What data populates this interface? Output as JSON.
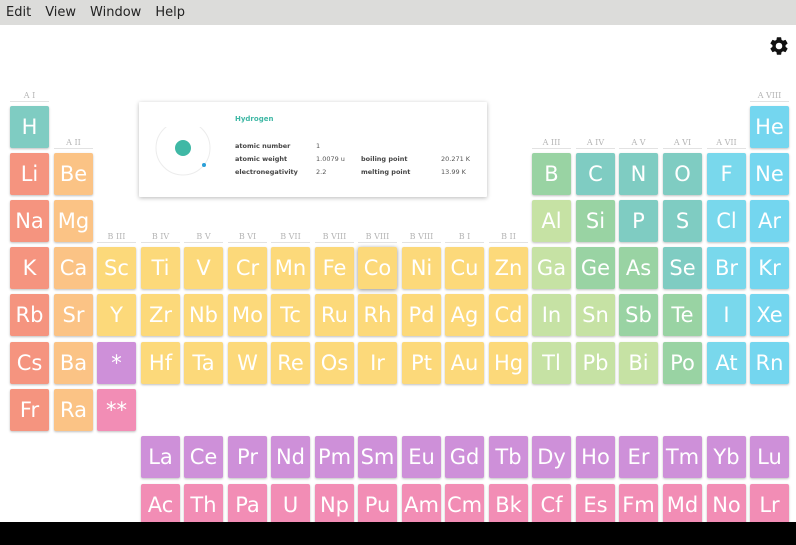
{
  "menu": [
    "Edit",
    "View",
    "Window",
    "Help"
  ],
  "colors": {
    "alkali": "#f5947f",
    "alkaline": "#fbc385",
    "transition": "#fcd97a",
    "post_transition": "#c6e2a4",
    "metalloid": "#99d3a3",
    "nonmetal": "#7fccc2",
    "halogen": "#79d8ec",
    "noble": "#74d6ef",
    "lanthanide": "#ce90d9",
    "actinide": "#f28db5",
    "hydrogen": "#7fccc2"
  },
  "group_labels": [
    "A I",
    "A II",
    "B III",
    "B IV",
    "B V",
    "B VI",
    "B VII",
    "B VIII",
    "B VIII",
    "B VIII",
    "B I",
    "B II",
    "A III",
    "A IV",
    "A V",
    "A VI",
    "A VII",
    "A VIII"
  ],
  "elements": [
    {
      "s": "H",
      "r": 0,
      "c": 0,
      "t": "hydrogen"
    },
    {
      "s": "He",
      "r": 0,
      "c": 17,
      "t": "noble"
    },
    {
      "s": "Li",
      "r": 1,
      "c": 0,
      "t": "alkali"
    },
    {
      "s": "Be",
      "r": 1,
      "c": 1,
      "t": "alkaline"
    },
    {
      "s": "B",
      "r": 1,
      "c": 12,
      "t": "metalloid"
    },
    {
      "s": "C",
      "r": 1,
      "c": 13,
      "t": "nonmetal"
    },
    {
      "s": "N",
      "r": 1,
      "c": 14,
      "t": "nonmetal"
    },
    {
      "s": "O",
      "r": 1,
      "c": 15,
      "t": "nonmetal"
    },
    {
      "s": "F",
      "r": 1,
      "c": 16,
      "t": "halogen"
    },
    {
      "s": "Ne",
      "r": 1,
      "c": 17,
      "t": "noble"
    },
    {
      "s": "Na",
      "r": 2,
      "c": 0,
      "t": "alkali"
    },
    {
      "s": "Mg",
      "r": 2,
      "c": 1,
      "t": "alkaline"
    },
    {
      "s": "Al",
      "r": 2,
      "c": 12,
      "t": "post_transition"
    },
    {
      "s": "Si",
      "r": 2,
      "c": 13,
      "t": "metalloid"
    },
    {
      "s": "P",
      "r": 2,
      "c": 14,
      "t": "nonmetal"
    },
    {
      "s": "S",
      "r": 2,
      "c": 15,
      "t": "nonmetal"
    },
    {
      "s": "Cl",
      "r": 2,
      "c": 16,
      "t": "halogen"
    },
    {
      "s": "Ar",
      "r": 2,
      "c": 17,
      "t": "noble"
    },
    {
      "s": "K",
      "r": 3,
      "c": 0,
      "t": "alkali"
    },
    {
      "s": "Ca",
      "r": 3,
      "c": 1,
      "t": "alkaline"
    },
    {
      "s": "Sc",
      "r": 3,
      "c": 2,
      "t": "transition"
    },
    {
      "s": "Ti",
      "r": 3,
      "c": 3,
      "t": "transition"
    },
    {
      "s": "V",
      "r": 3,
      "c": 4,
      "t": "transition"
    },
    {
      "s": "Cr",
      "r": 3,
      "c": 5,
      "t": "transition"
    },
    {
      "s": "Mn",
      "r": 3,
      "c": 6,
      "t": "transition"
    },
    {
      "s": "Fe",
      "r": 3,
      "c": 7,
      "t": "transition"
    },
    {
      "s": "Co",
      "r": 3,
      "c": 8,
      "t": "transition",
      "selected": true
    },
    {
      "s": "Ni",
      "r": 3,
      "c": 9,
      "t": "transition"
    },
    {
      "s": "Cu",
      "r": 3,
      "c": 10,
      "t": "transition"
    },
    {
      "s": "Zn",
      "r": 3,
      "c": 11,
      "t": "transition"
    },
    {
      "s": "Ga",
      "r": 3,
      "c": 12,
      "t": "post_transition"
    },
    {
      "s": "Ge",
      "r": 3,
      "c": 13,
      "t": "metalloid"
    },
    {
      "s": "As",
      "r": 3,
      "c": 14,
      "t": "metalloid"
    },
    {
      "s": "Se",
      "r": 3,
      "c": 15,
      "t": "nonmetal"
    },
    {
      "s": "Br",
      "r": 3,
      "c": 16,
      "t": "halogen"
    },
    {
      "s": "Kr",
      "r": 3,
      "c": 17,
      "t": "noble"
    },
    {
      "s": "Rb",
      "r": 4,
      "c": 0,
      "t": "alkali"
    },
    {
      "s": "Sr",
      "r": 4,
      "c": 1,
      "t": "alkaline"
    },
    {
      "s": "Y",
      "r": 4,
      "c": 2,
      "t": "transition"
    },
    {
      "s": "Zr",
      "r": 4,
      "c": 3,
      "t": "transition"
    },
    {
      "s": "Nb",
      "r": 4,
      "c": 4,
      "t": "transition"
    },
    {
      "s": "Mo",
      "r": 4,
      "c": 5,
      "t": "transition"
    },
    {
      "s": "Tc",
      "r": 4,
      "c": 6,
      "t": "transition"
    },
    {
      "s": "Ru",
      "r": 4,
      "c": 7,
      "t": "transition"
    },
    {
      "s": "Rh",
      "r": 4,
      "c": 8,
      "t": "transition"
    },
    {
      "s": "Pd",
      "r": 4,
      "c": 9,
      "t": "transition"
    },
    {
      "s": "Ag",
      "r": 4,
      "c": 10,
      "t": "transition"
    },
    {
      "s": "Cd",
      "r": 4,
      "c": 11,
      "t": "transition"
    },
    {
      "s": "In",
      "r": 4,
      "c": 12,
      "t": "post_transition"
    },
    {
      "s": "Sn",
      "r": 4,
      "c": 13,
      "t": "post_transition"
    },
    {
      "s": "Sb",
      "r": 4,
      "c": 14,
      "t": "metalloid"
    },
    {
      "s": "Te",
      "r": 4,
      "c": 15,
      "t": "metalloid"
    },
    {
      "s": "I",
      "r": 4,
      "c": 16,
      "t": "halogen"
    },
    {
      "s": "Xe",
      "r": 4,
      "c": 17,
      "t": "noble"
    },
    {
      "s": "Cs",
      "r": 5,
      "c": 0,
      "t": "alkali"
    },
    {
      "s": "Ba",
      "r": 5,
      "c": 1,
      "t": "alkaline"
    },
    {
      "s": "*",
      "r": 5,
      "c": 2,
      "t": "lanthanide"
    },
    {
      "s": "Hf",
      "r": 5,
      "c": 3,
      "t": "transition"
    },
    {
      "s": "Ta",
      "r": 5,
      "c": 4,
      "t": "transition"
    },
    {
      "s": "W",
      "r": 5,
      "c": 5,
      "t": "transition"
    },
    {
      "s": "Re",
      "r": 5,
      "c": 6,
      "t": "transition"
    },
    {
      "s": "Os",
      "r": 5,
      "c": 7,
      "t": "transition"
    },
    {
      "s": "Ir",
      "r": 5,
      "c": 8,
      "t": "transition"
    },
    {
      "s": "Pt",
      "r": 5,
      "c": 9,
      "t": "transition"
    },
    {
      "s": "Au",
      "r": 5,
      "c": 10,
      "t": "transition"
    },
    {
      "s": "Hg",
      "r": 5,
      "c": 11,
      "t": "transition"
    },
    {
      "s": "Tl",
      "r": 5,
      "c": 12,
      "t": "post_transition"
    },
    {
      "s": "Pb",
      "r": 5,
      "c": 13,
      "t": "post_transition"
    },
    {
      "s": "Bi",
      "r": 5,
      "c": 14,
      "t": "post_transition"
    },
    {
      "s": "Po",
      "r": 5,
      "c": 15,
      "t": "metalloid"
    },
    {
      "s": "At",
      "r": 5,
      "c": 16,
      "t": "halogen"
    },
    {
      "s": "Rn",
      "r": 5,
      "c": 17,
      "t": "noble"
    },
    {
      "s": "Fr",
      "r": 6,
      "c": 0,
      "t": "alkali"
    },
    {
      "s": "Ra",
      "r": 6,
      "c": 1,
      "t": "alkaline"
    },
    {
      "s": "**",
      "r": 6,
      "c": 2,
      "t": "actinide"
    },
    {
      "s": "La",
      "r": 7,
      "c": 3,
      "t": "lanthanide"
    },
    {
      "s": "Ce",
      "r": 7,
      "c": 4,
      "t": "lanthanide"
    },
    {
      "s": "Pr",
      "r": 7,
      "c": 5,
      "t": "lanthanide"
    },
    {
      "s": "Nd",
      "r": 7,
      "c": 6,
      "t": "lanthanide"
    },
    {
      "s": "Pm",
      "r": 7,
      "c": 7,
      "t": "lanthanide"
    },
    {
      "s": "Sm",
      "r": 7,
      "c": 8,
      "t": "lanthanide"
    },
    {
      "s": "Eu",
      "r": 7,
      "c": 9,
      "t": "lanthanide"
    },
    {
      "s": "Gd",
      "r": 7,
      "c": 10,
      "t": "lanthanide"
    },
    {
      "s": "Tb",
      "r": 7,
      "c": 11,
      "t": "lanthanide"
    },
    {
      "s": "Dy",
      "r": 7,
      "c": 12,
      "t": "lanthanide"
    },
    {
      "s": "Ho",
      "r": 7,
      "c": 13,
      "t": "lanthanide"
    },
    {
      "s": "Er",
      "r": 7,
      "c": 14,
      "t": "lanthanide"
    },
    {
      "s": "Tm",
      "r": 7,
      "c": 15,
      "t": "lanthanide"
    },
    {
      "s": "Yb",
      "r": 7,
      "c": 16,
      "t": "lanthanide"
    },
    {
      "s": "Lu",
      "r": 7,
      "c": 17,
      "t": "lanthanide"
    },
    {
      "s": "Ac",
      "r": 8,
      "c": 3,
      "t": "actinide"
    },
    {
      "s": "Th",
      "r": 8,
      "c": 4,
      "t": "actinide"
    },
    {
      "s": "Pa",
      "r": 8,
      "c": 5,
      "t": "actinide"
    },
    {
      "s": "U",
      "r": 8,
      "c": 6,
      "t": "actinide"
    },
    {
      "s": "Np",
      "r": 8,
      "c": 7,
      "t": "actinide"
    },
    {
      "s": "Pu",
      "r": 8,
      "c": 8,
      "t": "actinide"
    },
    {
      "s": "Am",
      "r": 8,
      "c": 9,
      "t": "actinide"
    },
    {
      "s": "Cm",
      "r": 8,
      "c": 10,
      "t": "actinide"
    },
    {
      "s": "Bk",
      "r": 8,
      "c": 11,
      "t": "actinide"
    },
    {
      "s": "Cf",
      "r": 8,
      "c": 12,
      "t": "actinide"
    },
    {
      "s": "Es",
      "r": 8,
      "c": 13,
      "t": "actinide"
    },
    {
      "s": "Fm",
      "r": 8,
      "c": 14,
      "t": "actinide"
    },
    {
      "s": "Md",
      "r": 8,
      "c": 15,
      "t": "actinide"
    },
    {
      "s": "No",
      "r": 8,
      "c": 16,
      "t": "actinide"
    },
    {
      "s": "Lr",
      "r": 8,
      "c": 17,
      "t": "actinide"
    }
  ],
  "card": {
    "name": "Hydrogen",
    "atomic_number_label": "atomic number",
    "atomic_number": "1",
    "atomic_weight_label": "atomic weight",
    "atomic_weight": "1.0079 u",
    "electronegativity_label": "electronegativity",
    "electronegativity": "2.2",
    "boiling_point_label": "boiling point",
    "boiling_point": "20.271 K",
    "melting_point_label": "melting point",
    "melting_point": "13.99 K"
  },
  "icons": {
    "settings": "gear-icon",
    "atom": "atom-icon"
  }
}
